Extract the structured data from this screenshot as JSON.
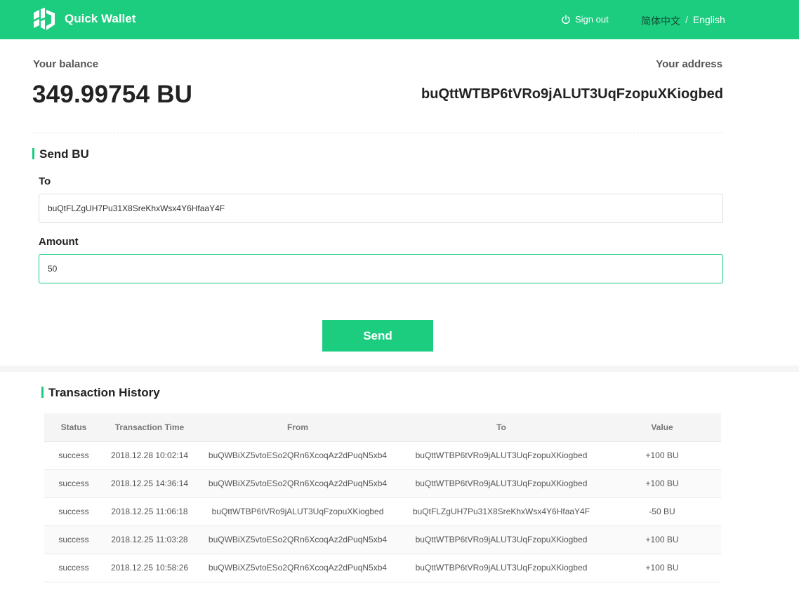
{
  "app": {
    "brand": "Quick Wallet",
    "sign_out": "Sign out",
    "lang_zh": "简体中文",
    "lang_sep": "/",
    "lang_en": "English",
    "accent_color": "#1ccc7f"
  },
  "account": {
    "balance_label": "Your balance",
    "balance": "349.99754 BU",
    "address_label": "Your address",
    "address": "buQttWTBP6tVRo9jALUT3UqFzopuXKiogbed"
  },
  "send": {
    "title": "Send BU",
    "to_label": "To",
    "to_value": "buQtFLZgUH7Pu31X8SreKhxWsx4Y6HfaaY4F",
    "amount_label": "Amount",
    "amount_value": "50",
    "button": "Send"
  },
  "history": {
    "title": "Transaction History",
    "columns": [
      "Status",
      "Transaction Time",
      "From",
      "To",
      "Value"
    ],
    "rows": [
      [
        "success",
        "2018.12.28 10:02:14",
        "buQWBiXZ5vtoESo2QRn6XcoqAz2dPuqN5xb4",
        "buQttWTBP6tVRo9jALUT3UqFzopuXKiogbed",
        "+100 BU"
      ],
      [
        "success",
        "2018.12.25 14:36:14",
        "buQWBiXZ5vtoESo2QRn6XcoqAz2dPuqN5xb4",
        "buQttWTBP6tVRo9jALUT3UqFzopuXKiogbed",
        "+100 BU"
      ],
      [
        "success",
        "2018.12.25 11:06:18",
        "buQttWTBP6tVRo9jALUT3UqFzopuXKiogbed",
        "buQtFLZgUH7Pu31X8SreKhxWsx4Y6HfaaY4F",
        "-50 BU"
      ],
      [
        "success",
        "2018.12.25 11:03:28",
        "buQWBiXZ5vtoESo2QRn6XcoqAz2dPuqN5xb4",
        "buQttWTBP6tVRo9jALUT3UqFzopuXKiogbed",
        "+100 BU"
      ],
      [
        "success",
        "2018.12.25 10:58:26",
        "buQWBiXZ5vtoESo2QRn6XcoqAz2dPuqN5xb4",
        "buQttWTBP6tVRo9jALUT3UqFzopuXKiogbed",
        "+100 BU"
      ]
    ]
  }
}
